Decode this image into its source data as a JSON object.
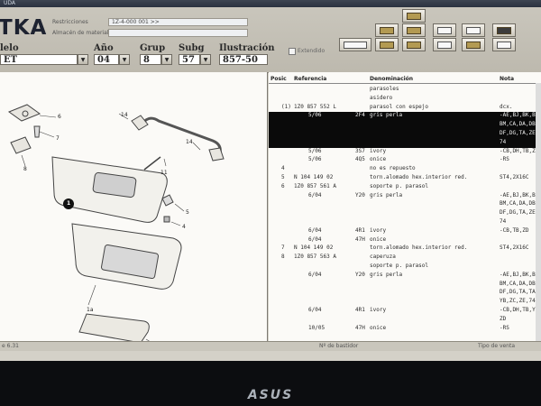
{
  "titlebar": {
    "text": "UDA"
  },
  "app": {
    "logo": "TKA"
  },
  "fields": {
    "restrictions_label": "Restricciones",
    "restrictions_value": "1Z-4-000 001 >>",
    "material_label": "Almacén de material",
    "material_value": ""
  },
  "selectors": {
    "model_label": "lelo",
    "model_value": "ET",
    "year_label": "Año",
    "year_value": "04",
    "group_label": "Grup",
    "group_value": "8",
    "subgroup_label": "Subg",
    "subgroup_value": "57",
    "illustration_label": "Ilustración",
    "illustration_value": "857-50",
    "extended_label": "Extendido"
  },
  "table": {
    "headers": {
      "pos": "Posic",
      "ref": "Referencia",
      "name": "Denominación",
      "note": "Nota"
    },
    "rows": [
      {
        "pos": "",
        "ref": "",
        "date": "",
        "code": "",
        "name": "parasoles",
        "note": "",
        "selected": false
      },
      {
        "pos": "",
        "ref": "",
        "date": "",
        "code": "",
        "name": "asidero",
        "note": "",
        "selected": false
      },
      {
        "pos": "(1)",
        "ref": "1Z0 857 552 L",
        "date": "",
        "code": "",
        "name": "parasol con espejo",
        "note": "dcx.",
        "selected": false
      },
      {
        "pos": "",
        "ref": "",
        "date": "5/06",
        "code": "2F4",
        "name": "gris perla",
        "note": "-AE,BJ,BK,B",
        "selected": true
      },
      {
        "pos": "",
        "ref": "",
        "date": "",
        "code": "",
        "name": "",
        "note": "BM,CA,DA,DB",
        "selected": true
      },
      {
        "pos": "",
        "ref": "",
        "date": "",
        "code": "",
        "name": "",
        "note": "DF,DG,TA,ZE",
        "selected": true
      },
      {
        "pos": "",
        "ref": "",
        "date": "",
        "code": "",
        "name": "",
        "note": "74",
        "selected": true
      },
      {
        "pos": "",
        "ref": "",
        "date": "5/06",
        "code": "3S7",
        "name": "ivory",
        "note": "-CB,DH,TB,Z",
        "selected": false
      },
      {
        "pos": "",
        "ref": "",
        "date": "5/06",
        "code": "4Q5",
        "name": "onice",
        "note": "-RS",
        "selected": false
      },
      {
        "pos": "4",
        "ref": "",
        "date": "",
        "code": "",
        "name": "no es repuesto",
        "note": "",
        "selected": false
      },
      {
        "pos": "5",
        "ref": "N 104 149 02",
        "date": "",
        "code": "",
        "name": "torn.alomado hex.interior red.",
        "note": "ST4,2X16C",
        "selected": false
      },
      {
        "pos": "6",
        "ref": "1Z0 857 561 A",
        "date": "",
        "code": "",
        "name": "soporte p. parasol",
        "note": "",
        "selected": false
      },
      {
        "pos": "",
        "ref": "",
        "date": "6/04",
        "code": "Y20",
        "name": "gris perla",
        "note": "-AE,BJ,BK,B",
        "selected": false
      },
      {
        "pos": "",
        "ref": "",
        "date": "",
        "code": "",
        "name": "",
        "note": "BM,CA,DA,DB",
        "selected": false
      },
      {
        "pos": "",
        "ref": "",
        "date": "",
        "code": "",
        "name": "",
        "note": "DF,DG,TA,ZE",
        "selected": false
      },
      {
        "pos": "",
        "ref": "",
        "date": "",
        "code": "",
        "name": "",
        "note": "74",
        "selected": false
      },
      {
        "pos": "",
        "ref": "",
        "date": "6/04",
        "code": "4R1",
        "name": "ivory",
        "note": "-CB,TB,ZD",
        "selected": false
      },
      {
        "pos": "",
        "ref": "",
        "date": "6/04",
        "code": "47H",
        "name": "onice",
        "note": "",
        "selected": false
      },
      {
        "pos": "7",
        "ref": "N 104 149 02",
        "date": "",
        "code": "",
        "name": "torn.alomado hex.interior red.",
        "note": "ST4,2X16C",
        "selected": false
      },
      {
        "pos": "8",
        "ref": "1Z0 857 563 A",
        "date": "",
        "code": "",
        "name": "caperuza",
        "note": "",
        "selected": false
      },
      {
        "pos": "",
        "ref": "",
        "date": "",
        "code": "",
        "name": "soporte p. parasol",
        "note": "",
        "selected": false
      },
      {
        "pos": "",
        "ref": "",
        "date": "6/04",
        "code": "Y20",
        "name": "gris perla",
        "note": "-AE,BJ,BK,BL",
        "selected": false
      },
      {
        "pos": "",
        "ref": "",
        "date": "",
        "code": "",
        "name": "",
        "note": "BM,CA,DA,DB",
        "selected": false
      },
      {
        "pos": "",
        "ref": "",
        "date": "",
        "code": "",
        "name": "",
        "note": "DF,DG,TA,TA",
        "selected": false
      },
      {
        "pos": "",
        "ref": "",
        "date": "",
        "code": "",
        "name": "",
        "note": "YB,ZC,ZE,74",
        "selected": false
      },
      {
        "pos": "",
        "ref": "",
        "date": "6/04",
        "code": "4R1",
        "name": "ivory",
        "note": "-CB,DH,TB,YC",
        "selected": false
      },
      {
        "pos": "",
        "ref": "",
        "date": "",
        "code": "",
        "name": "",
        "note": "ZD",
        "selected": false
      },
      {
        "pos": "",
        "ref": "",
        "date": "10/05",
        "code": "47H",
        "name": "onice",
        "note": "-RS",
        "selected": false
      }
    ]
  },
  "diagram": {
    "callouts": [
      "6",
      "7",
      "8",
      "14",
      "14",
      "11",
      "5",
      "4",
      "1",
      "1a",
      "9"
    ]
  },
  "status": {
    "left": "e 6.31",
    "middle": "Nº de bastidor",
    "right": "Tipo de venta"
  },
  "monitor": {
    "brand": "ASUS"
  },
  "colors": {
    "selection": "#0a0a0a",
    "header_bg": "#c4c1b6",
    "panel_bg": "#fbfaf7"
  }
}
